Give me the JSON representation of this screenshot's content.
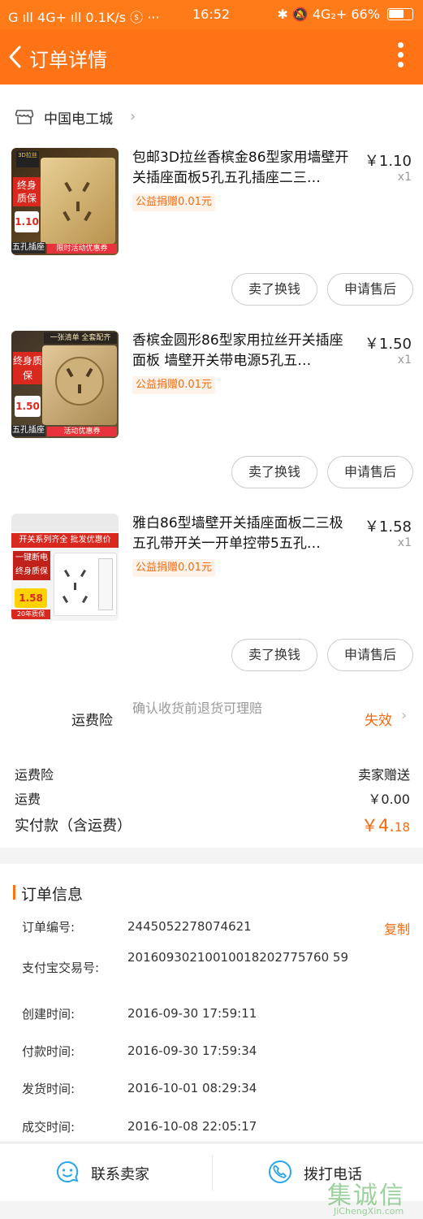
{
  "status_bar": {
    "left": "G ıll  4G+ ıll  0.1K/s  ⓢ  ···",
    "time": "16:52",
    "right": "✱  🔕 4G₂+  66%",
    "battery_level": 0.66
  },
  "header": {
    "title": "订单详情"
  },
  "shop": {
    "name": "中国电工城"
  },
  "items": [
    {
      "name": "包邮3D拉丝香槟金86型家用墙壁开关插座面板5孔五孔插座二三…",
      "donation": "公益捐赠0.01元",
      "price": "￥1.10",
      "qty": "x1",
      "thumb": {
        "badge": "终身质保",
        "price": "1.10",
        "tag": "五孔插座",
        "bottom": "限时活动优惠券",
        "top": "3D拉丝"
      },
      "btn_sell": "卖了换钱",
      "btn_after": "申请售后"
    },
    {
      "name": "香槟金圆形86型家用拉丝开关插座面板 墙壁开关带电源5孔五…",
      "donation": "公益捐赠0.01元",
      "price": "￥1.50",
      "qty": "x1",
      "thumb": {
        "badge": "终身质保",
        "price": "1.50",
        "tag": "五孔插座",
        "bottom": "活动优惠券",
        "top": "一张清单 全套配齐"
      },
      "btn_sell": "卖了换钱",
      "btn_after": "申请售后"
    },
    {
      "name": "雅白86型墙壁开关插座面板二三极五孔带开关一开单控带5五孔…",
      "donation": "公益捐赠0.01元",
      "price": "￥1.58",
      "qty": "x1",
      "thumb": {
        "badge": "开关系列齐全 批发优惠价",
        "price": "1.58",
        "tag": "一键断电 终身质保",
        "bottom": "20年质保",
        "top": ""
      },
      "btn_sell": "卖了换钱",
      "btn_after": "申请售后"
    }
  ],
  "insurance": {
    "label": "运费险",
    "desc": "确认收货前退货可理赔",
    "status": "失效"
  },
  "summary": {
    "ins_label": "运费险",
    "ins_value": "卖家赠送",
    "ship_label": "运费",
    "ship_value": "￥0.00",
    "total_label": "实付款（含运费）",
    "total_symbol": "￥",
    "total_int": "4.",
    "total_dec": "18"
  },
  "order_info": {
    "title": "订单信息",
    "copy": "复制",
    "rows": [
      {
        "label": "订单编号:",
        "value": "2445052278074621"
      },
      {
        "label": "支付宝交易号:",
        "value": "20160930210010018202775760 59"
      },
      {
        "label": "创建时间:",
        "value": "2016-09-30 17:59:11"
      },
      {
        "label": "付款时间:",
        "value": "2016-09-30 17:59:34"
      },
      {
        "label": "发货时间:",
        "value": "2016-10-01 08:29:34"
      },
      {
        "label": "成交时间:",
        "value": "2016-10-08 22:05:17"
      }
    ]
  },
  "bottom": {
    "contact": "联系卖家",
    "call": "拨打电话"
  },
  "watermark": {
    "cn": "集诚信",
    "en": "JiChengXin.com"
  },
  "colors": {
    "accent": "#ff7317",
    "orange_text": "#f26b10"
  }
}
